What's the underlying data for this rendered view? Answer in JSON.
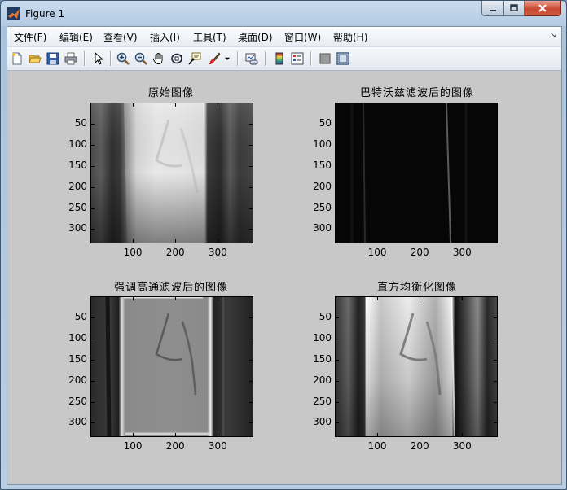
{
  "window": {
    "title": "Figure 1"
  },
  "menu": {
    "items": [
      "文件(F)",
      "编辑(E)",
      "查看(V)",
      "插入(I)",
      "工具(T)",
      "桌面(D)",
      "窗口(W)",
      "帮助(H)"
    ],
    "overflow_arrow": "↘"
  },
  "toolbar": {
    "icons": [
      "new-figure-icon",
      "open-file-icon",
      "save-icon",
      "print-icon",
      "select-arrow-icon",
      "zoom-in-icon",
      "zoom-out-icon",
      "pan-hand-icon",
      "rotate-3d-icon",
      "data-cursor-icon",
      "brush-icon",
      "brush-dropdown-icon",
      "link-plot-icon",
      "colorbar-icon",
      "legend-icon",
      "hide-plot-tools-icon",
      "show-plot-tools-icon"
    ]
  },
  "axes": [
    {
      "title": "原始图像",
      "yticks": [
        "50",
        "100",
        "150",
        "200",
        "250",
        "300"
      ],
      "xticks": [
        "100",
        "200",
        "300"
      ]
    },
    {
      "title": "巴特沃兹滤波后的图像",
      "yticks": [
        "50",
        "100",
        "150",
        "200",
        "250",
        "300"
      ],
      "xticks": [
        "100",
        "200",
        "300"
      ]
    },
    {
      "title": "强调高通滤波后的图像",
      "yticks": [
        "50",
        "100",
        "150",
        "200",
        "250",
        "300"
      ],
      "xticks": [
        "100",
        "200",
        "300"
      ]
    },
    {
      "title": "直方均衡化图像",
      "yticks": [
        "50",
        "100",
        "150",
        "200",
        "250",
        "300"
      ],
      "xticks": [
        "100",
        "200",
        "300"
      ]
    }
  ],
  "colors": {
    "figure_background": "#c8c8c8",
    "window_frame": "#b4cbe3",
    "close_button": "#c8482f"
  }
}
